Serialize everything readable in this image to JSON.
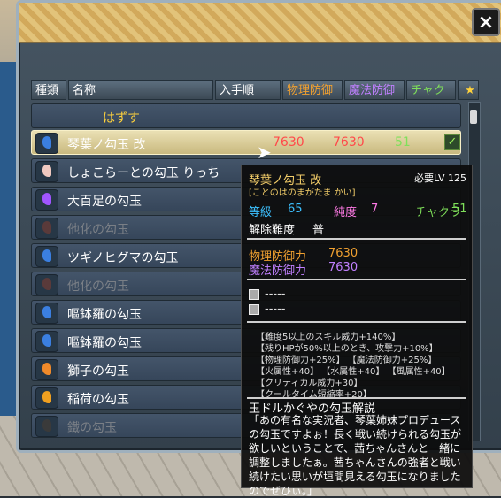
{
  "window": {
    "close_label": "×"
  },
  "header": {
    "kind": "種類",
    "name": "名称",
    "order": "入手順",
    "phys": "物理防御力",
    "mag": "魔法防御力",
    "chak": "チャクラ",
    "star": "★"
  },
  "rows": [
    {
      "name": "はずす",
      "type": "none"
    },
    {
      "name": "琴葉ノ勾玉 改",
      "phys": "7630",
      "mag": "7630",
      "chak": "51",
      "selected": true,
      "gem_color": "#3b7fe0",
      "check": true
    },
    {
      "name": "しょこらーとの勾玉 りっち",
      "gem_color": "#f0c9c0"
    },
    {
      "name": "大百足の勾玉",
      "gem_color": "#a055ff"
    },
    {
      "name": "他化の勾玉",
      "dim": true,
      "gem_color": "#5a3a3a"
    },
    {
      "name": "ツギノヒグマの勾玉",
      "gem_color": "#3b7fe0"
    },
    {
      "name": "他化の勾玉",
      "dim": true,
      "gem_color": "#5a3a3a"
    },
    {
      "name": "嘔鉢羅の勾玉",
      "gem_color": "#3b7fe0"
    },
    {
      "name": "嘔鉢羅の勾玉",
      "gem_color": "#3b7fe0"
    },
    {
      "name": "獅子の勾玉",
      "gem_color": "#f08a2a"
    },
    {
      "name": "稲荷の勾玉",
      "gem_color": "#f0a020"
    },
    {
      "name": "鐵の勾玉",
      "dim": true,
      "gem_color": "#3a3a3a"
    }
  ],
  "check_mark": "✓",
  "tooltip": {
    "title": "琴葉ノ勾玉 改",
    "reading": "[ことのはのまがたま かい]",
    "level": "必要LV 125",
    "grade_label": "等級",
    "grade": "65",
    "purity_label": "純度",
    "purity": "7",
    "chakra_label": "チャクラ",
    "chakra": "51",
    "difficulty_label": "解除難度",
    "difficulty": "普",
    "phys_label": "物理防御力",
    "phys": "7630",
    "mag_label": "魔法防御力",
    "mag": "7630",
    "slot1": "-----",
    "slot2": "-----",
    "effects": [
      "【難度5以上のスキル威力+140%】",
      "【残りHPが50%以上のとき、攻撃力+10%】",
      "【物理防御力+25%】 【魔法防御力+25%】",
      "【火属性+40】 【水属性+40】 【風属性+40】",
      "【クリティカル威力+30】",
      "【クールタイム短縮率+20】"
    ],
    "desc_title": "玉ドルかぐやの勾玉解説",
    "desc": "「あの有名な実況者、琴葉姉妹プロデュースの勾玉ですよぉ！長く戦い続けられる勾玉が欲しいということで、茜ちゃんさんと一緒に調整しましたぁ。茜ちゃんさんの強者と戦い続けたい思いが垣間見える勾玉になりましたのでぜひぃ。」"
  }
}
